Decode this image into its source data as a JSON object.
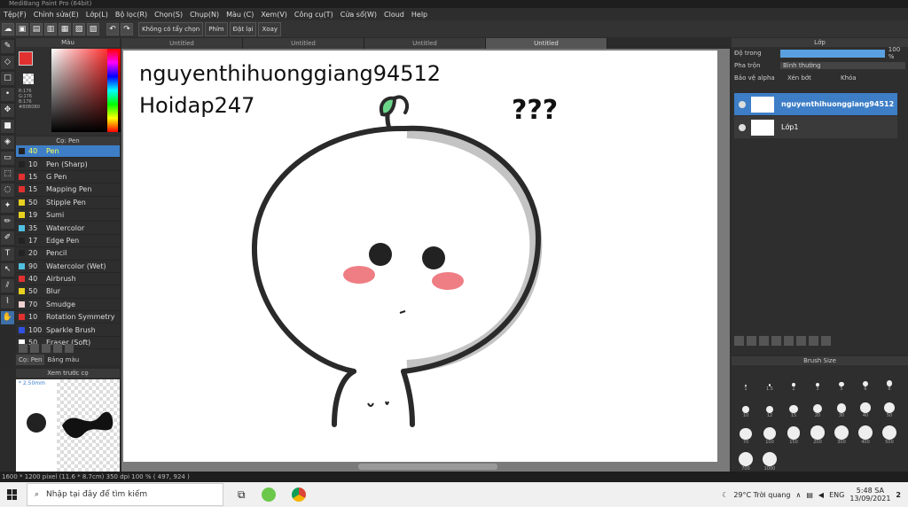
{
  "window": {
    "title": "MediBang Paint Pro (64bit)"
  },
  "menu": [
    "Tệp(F)",
    "Chỉnh sửa(E)",
    "Lớp(L)",
    "Bộ lọc(R)",
    "Chọn(S)",
    "Chụp(N)",
    "Màu (C)",
    "Xem(V)",
    "Công cụ(T)",
    "Cửa sổ(W)",
    "Cloud",
    "Help"
  ],
  "toolbar": {
    "antialias_label": "Không có tẩy chọn",
    "phim_label": "Phím",
    "dat_lai_label": "Đặt lại",
    "xoay_label": "Xoay"
  },
  "tabs": [
    "Untitled",
    "Untitled",
    "Untitled",
    "Untitled"
  ],
  "color_panel": {
    "title": "Màu",
    "r": "R:176",
    "g": "G:176",
    "b": "B:176",
    "hex": "#B0B0B0",
    "main_color": "#E03030"
  },
  "brush_panel": {
    "title": "Cọ: Pen",
    "brushes": [
      {
        "size": "40",
        "name": "Pen",
        "color": "#222222"
      },
      {
        "size": "10",
        "name": "Pen (Sharp)",
        "color": "#222222"
      },
      {
        "size": "15",
        "name": "G Pen",
        "color": "#e03030"
      },
      {
        "size": "15",
        "name": "Mapping Pen",
        "color": "#e03030"
      },
      {
        "size": "50",
        "name": "Stipple Pen",
        "color": "#e8d020"
      },
      {
        "size": "19",
        "name": "Sumi",
        "color": "#e8d020"
      },
      {
        "size": "35",
        "name": "Watercolor",
        "color": "#50c0e0"
      },
      {
        "size": "17",
        "name": "Edge Pen",
        "color": "#222222"
      },
      {
        "size": "20",
        "name": "Pencil",
        "color": "#222222"
      },
      {
        "size": "90",
        "name": "Watercolor (Wet)",
        "color": "#50c0e0"
      },
      {
        "size": "40",
        "name": "Airbrush",
        "color": "#e03030"
      },
      {
        "size": "50",
        "name": "Blur",
        "color": "#e8d020"
      },
      {
        "size": "70",
        "name": "Smudge",
        "color": "#f0d0d0"
      },
      {
        "size": "10",
        "name": "Rotation Symmetry",
        "color": "#e03030"
      },
      {
        "size": "100",
        "name": "Sparkle Brush",
        "color": "#3050e0"
      },
      {
        "size": "50",
        "name": "Eraser (Soft)",
        "color": "#ffffff"
      }
    ],
    "tab_brush": "Cọ: Pen",
    "tab_palette": "Bảng màu"
  },
  "preview_panel": {
    "title": "Xem trước cọ",
    "size_label": "* 2.50mm"
  },
  "canvas": {
    "text_line1": "nguyenthihuonggiang94512",
    "text_line2": "Hoidap247",
    "question_marks": "???"
  },
  "layer_panel": {
    "title": "Lớp",
    "opacity_label": "Độ trong",
    "opacity_value": "100 %",
    "blend_label": "Pha trộn",
    "blend_value": "Bình thường",
    "protect_alpha": "Bảo vệ alpha",
    "clipping": "Xén bớt",
    "lock": "Khóa",
    "layers": [
      {
        "name": "nguyenthihuonggiang94512",
        "selected": true
      },
      {
        "name": "Lớp1",
        "selected": false
      }
    ]
  },
  "brush_size_panel": {
    "title": "Brush Size",
    "sizes": [
      "1",
      "1.5",
      "2",
      "3",
      "5",
      "6",
      "8",
      "10",
      "12",
      "15",
      "20",
      "30",
      "40",
      "50",
      "70",
      "100",
      "150",
      "200",
      "300",
      "400",
      "500",
      "700",
      "1000"
    ]
  },
  "status": {
    "text": "1600 * 1200 pixel  (11.6 * 8.7cm)  350 dpi  100 %  ( 497, 924 )"
  },
  "taskbar": {
    "search_placeholder": "Nhập tại đây để tìm kiếm",
    "weather": "29°C  Trời quang",
    "lang": "ENG",
    "time": "5:48 SA",
    "date": "13/09/2021",
    "notif_count": "2"
  }
}
